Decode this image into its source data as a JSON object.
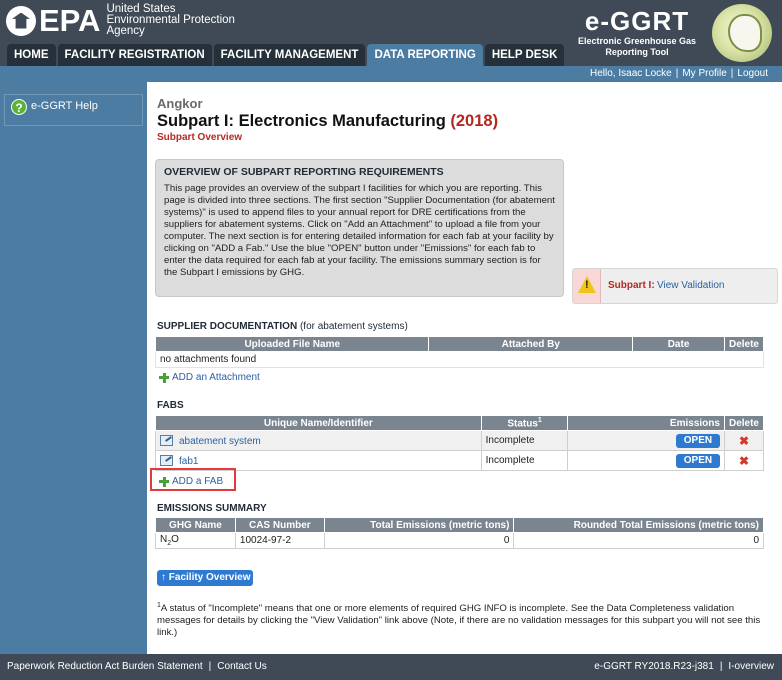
{
  "brand": {
    "epa_word": "EPA",
    "agency_line1": "United States",
    "agency_line2": "Environmental Protection",
    "agency_line3": "Agency",
    "app_name": "e-GGRT",
    "app_sub1": "Electronic Greenhouse Gas",
    "app_sub2": "Reporting Tool"
  },
  "nav": {
    "tabs": [
      {
        "label": "HOME"
      },
      {
        "label": "FACILITY REGISTRATION"
      },
      {
        "label": "FACILITY MANAGEMENT"
      },
      {
        "label": "DATA REPORTING"
      },
      {
        "label": "HELP DESK"
      }
    ],
    "active": "DATA REPORTING"
  },
  "userbar": {
    "greeting": "Hello, Isaac Locke",
    "profile": "My Profile",
    "logout": "Logout"
  },
  "sidebar": {
    "help_label": "e-GGRT Help"
  },
  "page": {
    "facility_name": "Angkor",
    "title": "Subpart I: Electronics Manufacturing",
    "year": "(2018)",
    "subtitle": "Subpart Overview"
  },
  "overview": {
    "title": "OVERVIEW OF SUBPART REPORTING REQUIREMENTS",
    "text": "This page provides an overview of the subpart I facilities for which you are reporting. This page is divided into three sections. The first section \"Supplier Documentation (for abatement systems)\" is used to append files to your annual report for DRE certifications from the suppliers for abatement systems. Click on \"Add an Attachment\" to upload a file from your computer. The next section is for entering detailed information for each fab at your facility by clicking on \"ADD a Fab.\" Use the blue \"OPEN\" button under \"Emissions\" for each fab to enter the data required for each fab at your facility. The emissions summary section is for the Subpart I emissions by GHG."
  },
  "validation": {
    "label": "Subpart I:",
    "link": "View Validation"
  },
  "supplier": {
    "title": "SUPPLIER DOCUMENTATION",
    "note": "(for abatement systems)",
    "columns": [
      "Uploaded File Name",
      "Attached By",
      "Date",
      "Delete"
    ],
    "empty": "no attachments found",
    "add_label": "ADD an Attachment"
  },
  "fabs": {
    "title": "FABS",
    "columns": [
      "Unique Name/Identifier",
      "Status",
      "Emissions",
      "Delete"
    ],
    "status_sup": "1",
    "rows": [
      {
        "name": "abatement system",
        "status": "Incomplete",
        "action": "OPEN"
      },
      {
        "name": "fab1",
        "status": "Incomplete",
        "action": "OPEN"
      }
    ],
    "delete_glyph": "✖",
    "add_label": "ADD a FAB"
  },
  "emissions": {
    "title": "EMISSIONS SUMMARY",
    "columns": [
      "GHG Name",
      "CAS Number",
      "Total Emissions (metric tons)",
      "Rounded Total Emissions (metric tons)"
    ],
    "rows": [
      {
        "ghg": "N2O",
        "cas": "10024-97-2",
        "total": "0",
        "rounded": "0"
      }
    ]
  },
  "facility_button": "Facility Overview",
  "footnote": {
    "marker": "1",
    "text": "A status of \"Incomplete\" means that one or more elements of required GHG INFO is incomplete. See the Data Completeness validation messages for details by clicking the \"View Validation\" link above (Note, if there are no validation messages for this subpart you will not see this link.)"
  },
  "footer": {
    "paperwork": "Paperwork Reduction Act Burden Statement",
    "contact": "Contact Us",
    "version": "e-GGRT RY2018.R23-j381",
    "page_id": "I-overview"
  },
  "colors": {
    "header_bg": "#3f4a56",
    "nav_active": "#4c7ca2",
    "accent_red": "#b22a20",
    "link_blue": "#2a5fa4",
    "button_blue": "#2f7ad1"
  }
}
